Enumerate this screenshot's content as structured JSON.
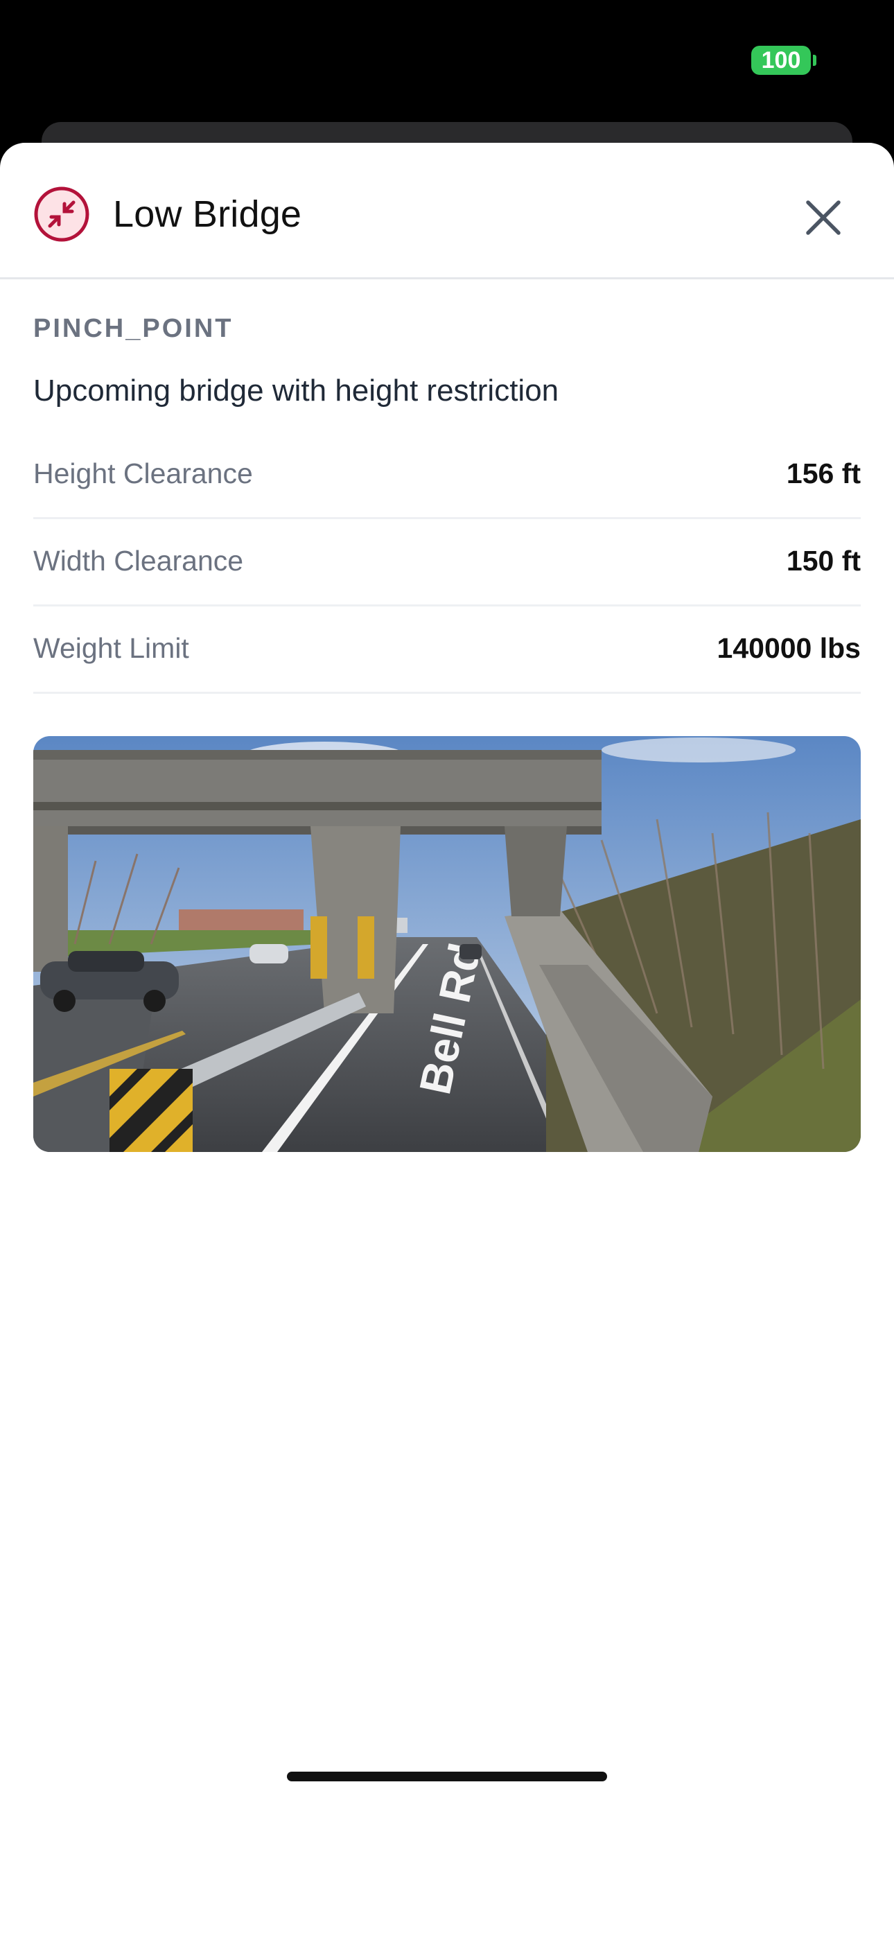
{
  "status_bar": {
    "battery": "100"
  },
  "sheet": {
    "title": "Low Bridge",
    "icon": "pinch-point-icon",
    "category": "PINCH_POINT",
    "description": "Upcoming bridge with height restriction",
    "details": [
      {
        "label": "Height Clearance",
        "value": "156 ft"
      },
      {
        "label": "Width Clearance",
        "value": "150 ft"
      },
      {
        "label": "Weight Limit",
        "value": "140000 lbs"
      }
    ],
    "photo": {
      "road_marking": "Bell Rd"
    }
  },
  "colors": {
    "accent": "#b3123a",
    "accent_bg": "#fde2e6",
    "battery": "#34c759"
  }
}
